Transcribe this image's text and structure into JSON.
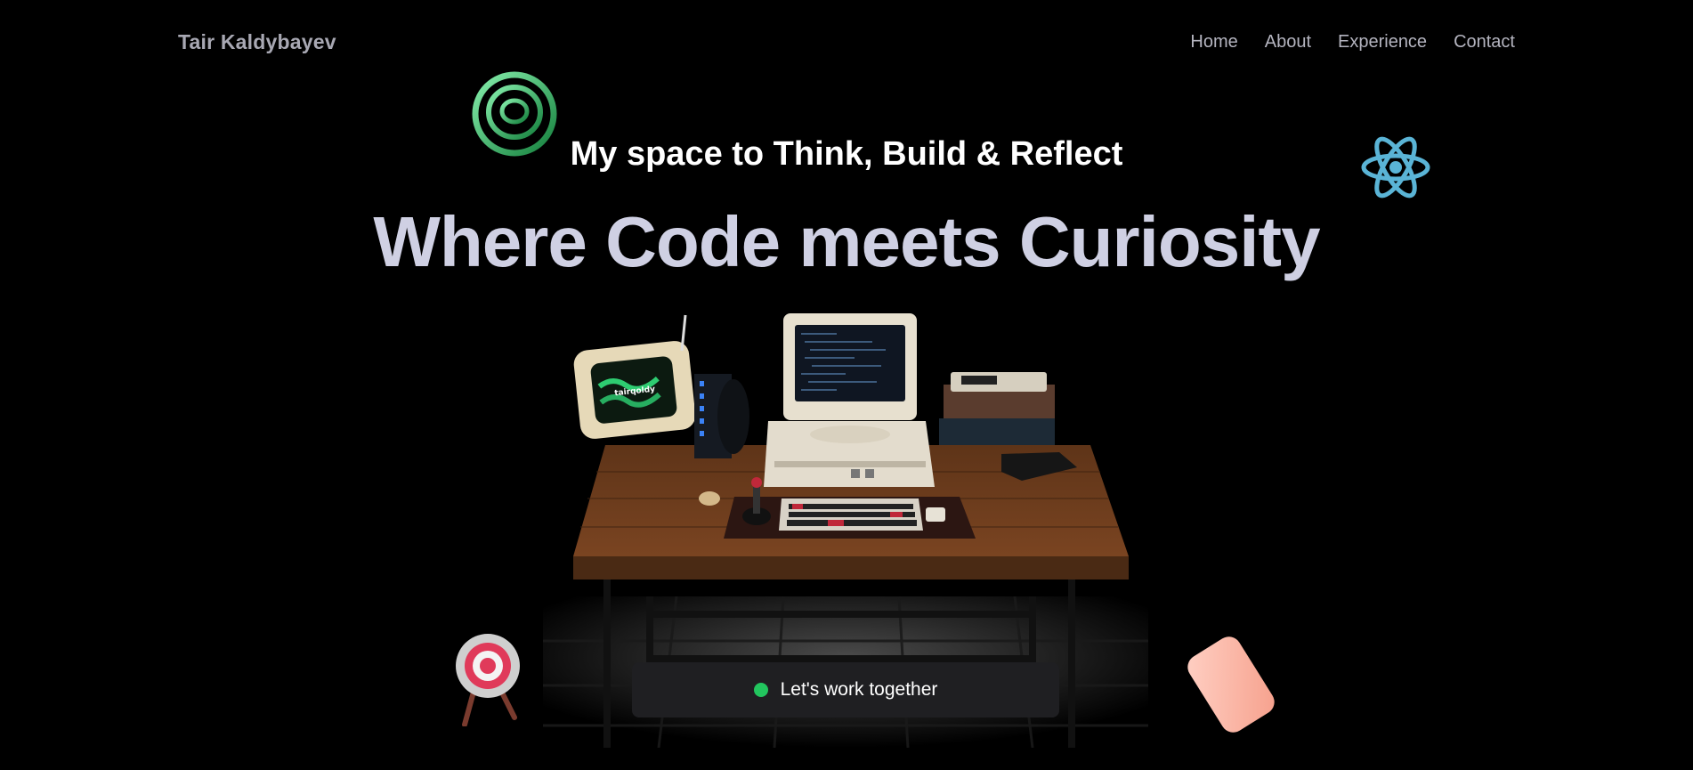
{
  "header": {
    "brand": "Tair Kaldybayev",
    "nav": [
      {
        "label": "Home"
      },
      {
        "label": "About"
      },
      {
        "label": "Experience"
      },
      {
        "label": "Contact"
      }
    ]
  },
  "hero": {
    "subtitle": "My space to Think, Build & Reflect",
    "headline": "Where Code meets Curiosity",
    "cta_label": "Let's work together"
  },
  "icons": {
    "top_left": "concentric-rings-icon",
    "top_right": "react-atom-icon",
    "bottom_left": "target-icon",
    "bottom_right": "eraser-icon"
  },
  "monitor_label": "tairqoldy",
  "colors": {
    "background": "#000000",
    "headline": "#cfd0e3",
    "cta_dot": "#22c55e",
    "cta_bg": "#1f1f22",
    "react": "#5ab4d6",
    "rings": "#4ade80"
  }
}
